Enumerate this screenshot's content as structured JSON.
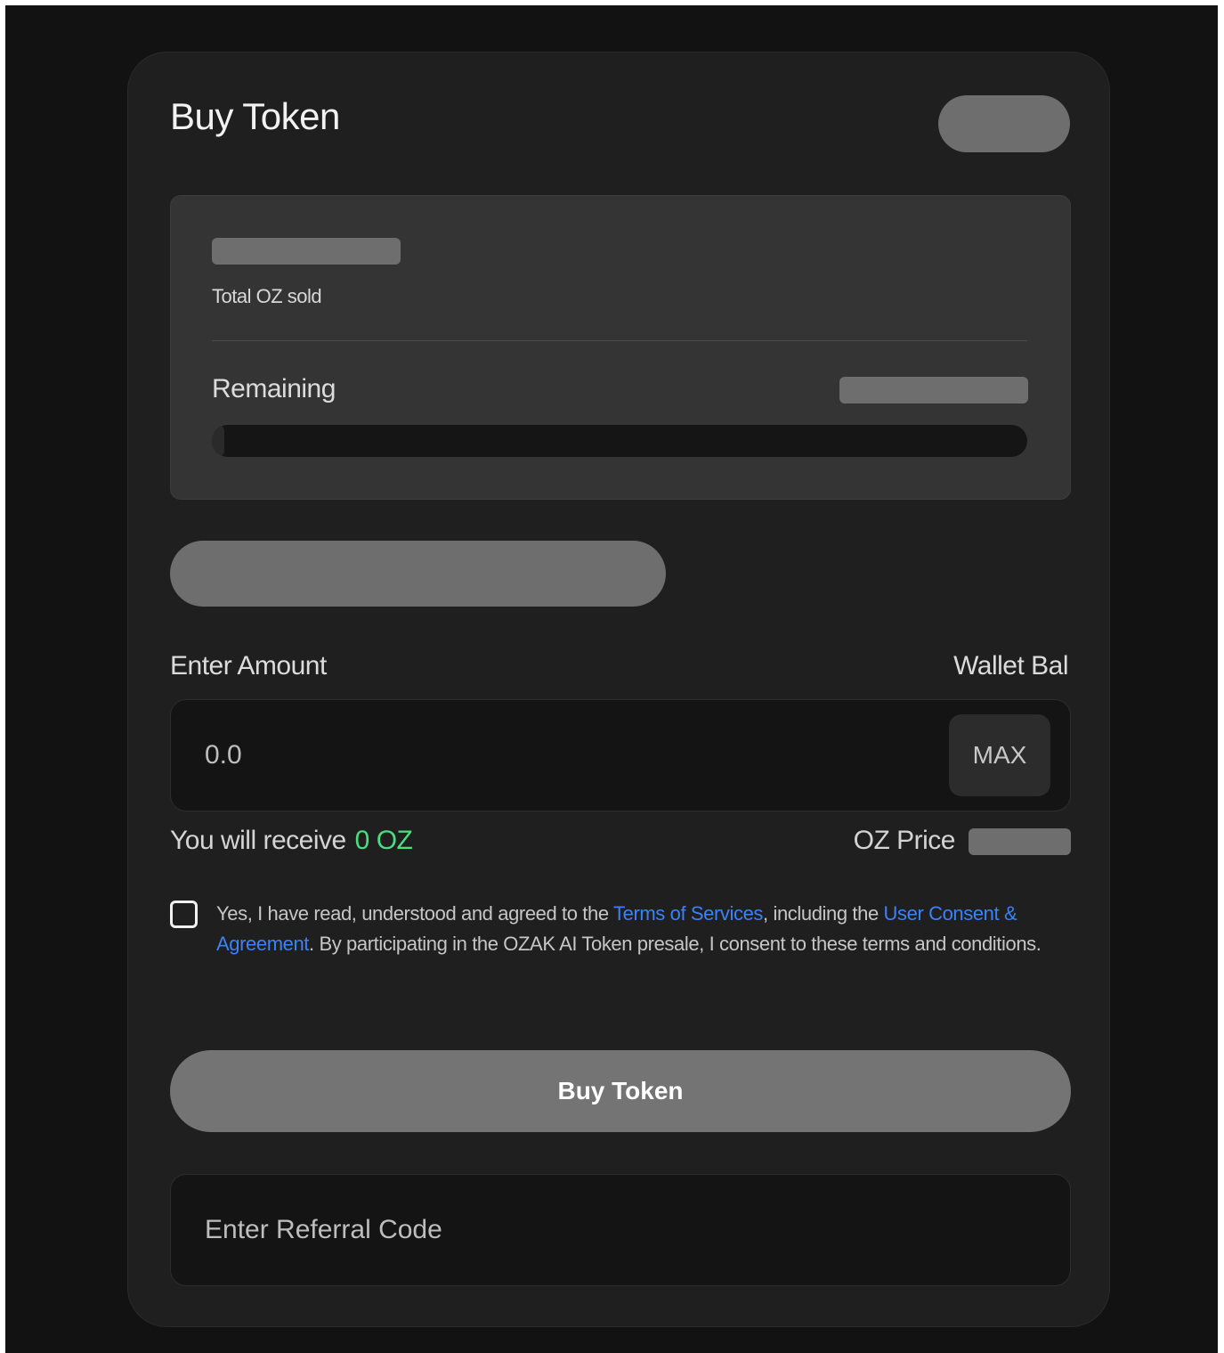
{
  "card": {
    "title": "Buy Token"
  },
  "stats": {
    "sold_label": "Total OZ sold",
    "remaining_label": "Remaining",
    "progress_fraction": 0.0
  },
  "amount": {
    "label": "Enter Amount",
    "wallet_label": "Wallet Bal",
    "placeholder": "0.0",
    "max_label": "MAX"
  },
  "receive": {
    "label": "You will receive",
    "amount": "0 OZ",
    "price_label": "OZ Price"
  },
  "consent": {
    "text_1": "Yes, I have read, understood and agreed to the ",
    "terms_link": "Terms of Services",
    "text_2": ", including the ",
    "consent_link": "User Consent & Agreement",
    "text_3": ". By participating in the OZAK AI Token presale, I consent to these terms and conditions."
  },
  "buy_button": {
    "label": "Buy Token"
  },
  "referral": {
    "placeholder": "Enter Referral Code"
  },
  "colors": {
    "page_background": "#121212",
    "card_background": "#1f1f1f",
    "stats_background": "#343434",
    "input_background": "#141414",
    "skeleton": "#6e6e6e",
    "accent_green": "#4ade80",
    "link_blue": "#3b82f6",
    "button_background": "#747474"
  }
}
